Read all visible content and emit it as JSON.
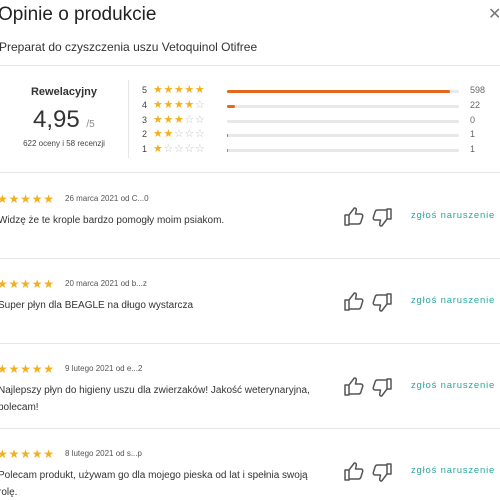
{
  "header": {
    "title": "Opinie o produkcie",
    "close_icon": "close-icon",
    "product_name": "Preparat do czyszczenia uszu Vetoquinol Otifree"
  },
  "summary": {
    "label": "Rewelacyjny",
    "score": "4,95",
    "score_max": "/5",
    "counts": "622 oceny i 58 recenzji"
  },
  "distribution": [
    {
      "stars": "5",
      "count": "598",
      "fraction": 0.961
    },
    {
      "stars": "4",
      "count": "22",
      "fraction": 0.035
    },
    {
      "stars": "3",
      "count": "0",
      "fraction": 0
    },
    {
      "stars": "2",
      "count": "1",
      "fraction": 0.002
    },
    {
      "stars": "1",
      "count": "1",
      "fraction": 0.002
    }
  ],
  "colors": {
    "star_on": "#f2b01e",
    "star_off": "#c4c4c4",
    "bar_fill": "#e4671b",
    "report_link": "#2aa5a0"
  },
  "reviews": [
    {
      "rating": 5,
      "meta": "26 marca 2021 od C...0",
      "text": "Widzę że te krople bardzo pomogły moim psiakom.",
      "report": "zgłoś naruszenie"
    },
    {
      "rating": 5,
      "meta": "20 marca 2021 od b...z",
      "text": "Super płyn dla BEAGLE na długo wystarcza",
      "report": "zgłoś naruszenie"
    },
    {
      "rating": 5,
      "meta": "9 lutego 2021 od e...2",
      "text": "Najlepszy płyn do higieny uszu dla zwierzaków! Jakość weterynaryjna, polecam!",
      "report": "zgłoś naruszenie"
    },
    {
      "rating": 5,
      "meta": "8 lutego 2021 od s...p",
      "text": "Polecam produkt, używam go dla mojego pieska od lat i spełnia swoją rolę.",
      "report": "zgłoś naruszenie"
    }
  ]
}
